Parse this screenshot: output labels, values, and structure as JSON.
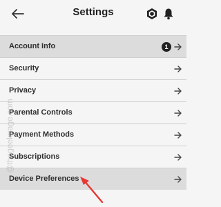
{
  "header": {
    "title": "Settings",
    "back_icon": "back-arrow-icon",
    "robux_icon": "robux-icon",
    "bell_icon": "bell-icon"
  },
  "settings": {
    "items": [
      {
        "label": "Account Info",
        "badge": "1",
        "highlighted": true
      },
      {
        "label": "Security"
      },
      {
        "label": "Privacy"
      },
      {
        "label": "Parental Controls"
      },
      {
        "label": "Payment Methods"
      },
      {
        "label": "Subscriptions"
      },
      {
        "label": "Device Preferences",
        "highlighted": true
      }
    ]
  },
  "watermark": "@thegeekpage.com",
  "colors": {
    "highlight_row": "#dcdcdc",
    "background": "#f5f5f5",
    "annotation_arrow": "#e53935"
  }
}
